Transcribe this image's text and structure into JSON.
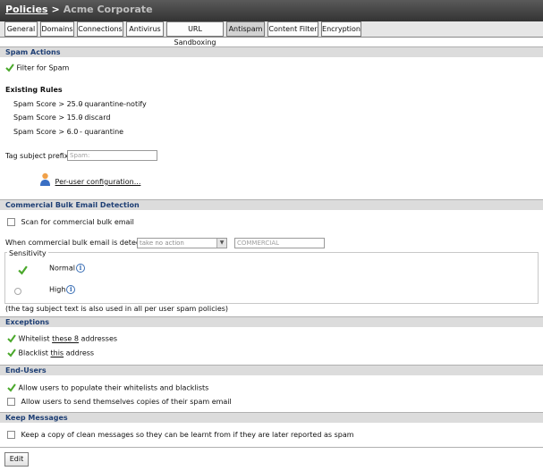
{
  "header": {
    "breadcrumb_root": "Policies",
    "separator": ">",
    "company": "Acme Corporate"
  },
  "tabs": [
    {
      "label": "General"
    },
    {
      "label": "Domains"
    },
    {
      "label": "Connections"
    },
    {
      "label": "Antivirus"
    },
    {
      "label": "URL Sandboxing"
    },
    {
      "label": "Antispam"
    },
    {
      "label": "Content Filter"
    },
    {
      "label": "Encryption"
    }
  ],
  "active_tab": "Antispam",
  "spam_actions": {
    "heading": "Spam Actions",
    "filter_label": "Filter for Spam",
    "filter_checked": true,
    "existing_rules_heading": "Existing Rules",
    "rules": [
      {
        "condition": "Spam Score > 25.0",
        "action": "- quarantine-notify"
      },
      {
        "condition": "Spam Score > 15.0",
        "action": "- discard"
      },
      {
        "condition": "Spam Score > 6.0",
        "action": "- quarantine"
      }
    ],
    "tag_prefix_label": "Tag subject prefix:",
    "tag_prefix_value": "Spam:",
    "per_user_link": "Per-user configuration..."
  },
  "bulk": {
    "heading": "Commercial Bulk Email Detection",
    "scan_label": "Scan for commercial bulk email",
    "scan_checked": false,
    "when_label": "When commercial bulk email is detected",
    "action_select": "take no action",
    "tag_value": "COMMERCIAL",
    "sensitivity_legend": "Sensitivity",
    "normal_label": "Normal",
    "high_label": "High",
    "selected_sensitivity": "Normal",
    "note": "(the tag subject text is also used in all per user spam policies)"
  },
  "exceptions": {
    "heading": "Exceptions",
    "whitelist_pre": "Whitelist",
    "whitelist_link": "these 8",
    "whitelist_post": "addresses",
    "blacklist_pre": "Blacklist",
    "blacklist_link": "this",
    "blacklist_post": "address"
  },
  "end_users": {
    "heading": "End-Users",
    "allow_populate": "Allow users to populate their whitelists and blacklists",
    "allow_populate_checked": true,
    "allow_copies": "Allow users to send themselves copies of their spam email",
    "allow_copies_checked": false
  },
  "keep_messages": {
    "heading": "Keep Messages",
    "keep_copy": "Keep a copy of clean messages so they can be learnt from if they are later reported as spam",
    "keep_copy_checked": false
  },
  "buttons": {
    "edit": "Edit"
  },
  "colors": {
    "section_heading_text": "#1d3e74",
    "section_heading_bg": "#dcdcdc",
    "check_green": "#4aa82b",
    "titlebar": "#444444"
  }
}
